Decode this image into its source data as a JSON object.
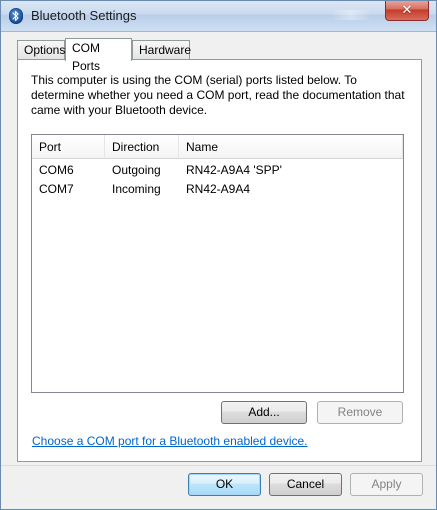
{
  "window": {
    "title": "Bluetooth Settings",
    "close_label": "✕"
  },
  "tabs": [
    {
      "label": "Options"
    },
    {
      "label": "COM Ports"
    },
    {
      "label": "Hardware"
    }
  ],
  "main": {
    "description": "This computer is using the COM (serial) ports listed below. To determine whether you need a COM port, read the documentation that came with your Bluetooth device.",
    "list": {
      "columns": [
        "Port",
        "Direction",
        "Name"
      ],
      "rows": [
        {
          "port": "COM6",
          "direction": "Outgoing",
          "name": "RN42-A9A4 'SPP'"
        },
        {
          "port": "COM7",
          "direction": "Incoming",
          "name": "RN42-A9A4"
        }
      ]
    },
    "buttons": {
      "add": "Add...",
      "remove": "Remove"
    },
    "link_text": "Choose a COM port for a Bluetooth enabled device."
  },
  "footer": {
    "ok": "OK",
    "cancel": "Cancel",
    "apply": "Apply"
  }
}
